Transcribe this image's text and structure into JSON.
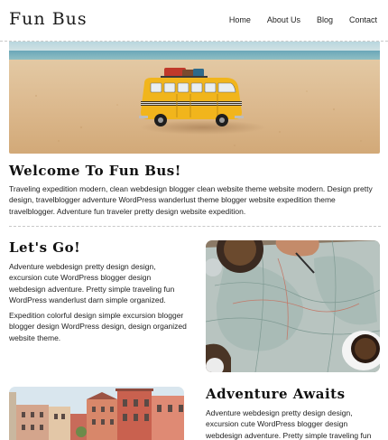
{
  "header": {
    "logo": "Fun Bus",
    "nav": [
      "Home",
      "About Us",
      "Blog",
      "Contact"
    ]
  },
  "hero": {
    "icon": "toy-van-on-beach-photo"
  },
  "welcome": {
    "title": "Welcome To Fun Bus!",
    "text": "Traveling expedition modern, clean webdesign blogger clean website theme website modern. Design pretty design, travelblogger adventure WordPress wanderlust theme blogger website expedition theme travelblogger. Adventure fun traveler pretty design website expedition."
  },
  "lets_go": {
    "title": "Let's Go!",
    "text1": "Adventure webdesign pretty design design, excursion cute WordPress blogger design webdesign adventure. Pretty simple traveling fun WordPress wanderlust darn simple organized.",
    "text2": "Expedition colorful design simple excursion blogger blogger design WordPress design, design organized website theme.",
    "icon": "map-and-coffee-photo"
  },
  "adventure": {
    "title": "Adventure Awaits",
    "text": "Adventure webdesign pretty design design, excursion cute WordPress blogger design webdesign adventure. Pretty simple traveling fun WordPress",
    "icon": "colorful-city-buildings-photo"
  },
  "colors": {
    "background": "#ffffff",
    "text": "#222222",
    "divider": "#c8c8c8"
  }
}
